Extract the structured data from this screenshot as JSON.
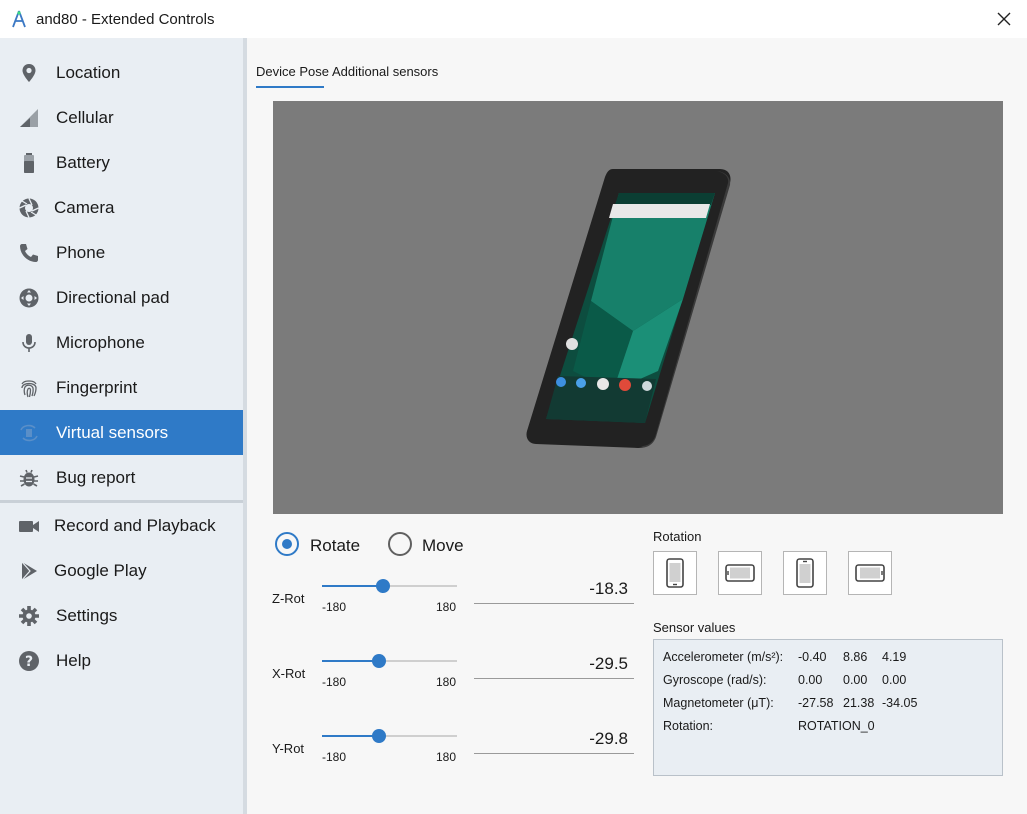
{
  "window": {
    "title": "and80 - Extended Controls"
  },
  "sidebar": {
    "items": [
      {
        "label": "Location"
      },
      {
        "label": "Cellular"
      },
      {
        "label": "Battery"
      },
      {
        "label": "Camera"
      },
      {
        "label": "Phone"
      },
      {
        "label": "Directional pad"
      },
      {
        "label": "Microphone"
      },
      {
        "label": "Fingerprint"
      },
      {
        "label": "Virtual sensors",
        "active": true
      },
      {
        "label": "Bug report"
      },
      {
        "label": "Record and Playback"
      },
      {
        "label": "Google Play"
      },
      {
        "label": "Settings"
      },
      {
        "label": "Help"
      }
    ]
  },
  "tabs": [
    {
      "label": "Device Pose",
      "active": true
    },
    {
      "label": "Additional sensors"
    }
  ],
  "mode": {
    "options": [
      {
        "label": "Rotate",
        "checked": true
      },
      {
        "label": "Move",
        "checked": false
      }
    ]
  },
  "sliders": [
    {
      "name": "Z-Rot",
      "min": "-180",
      "max": "180",
      "value": "-18.3"
    },
    {
      "name": "X-Rot",
      "min": "-180",
      "max": "180",
      "value": "-29.5"
    },
    {
      "name": "Y-Rot",
      "min": "-180",
      "max": "180",
      "value": "-29.8"
    }
  ],
  "rotation": {
    "label": "Rotation",
    "buttons": [
      "portrait-icon",
      "landscape-icon",
      "reverse-portrait-icon",
      "reverse-landscape-icon"
    ]
  },
  "sensor_values": {
    "label": "Sensor values",
    "rows": [
      {
        "name": "Accelerometer (m/s²):",
        "values": [
          "-0.40",
          "8.86",
          "4.19"
        ]
      },
      {
        "name": "Gyroscope (rad/s):",
        "values": [
          "0.00",
          "0.00",
          "0.00"
        ]
      },
      {
        "name": "Magnetometer (μT):",
        "values": [
          "-27.58",
          "21.38",
          "-34.05"
        ]
      },
      {
        "name": "Rotation:",
        "values": [
          "ROTATION_0"
        ]
      }
    ]
  },
  "colors": {
    "accent": "#2f7ac7",
    "sidebar_bg": "#e9eef3",
    "viewport_bg": "#7b7b7b"
  }
}
